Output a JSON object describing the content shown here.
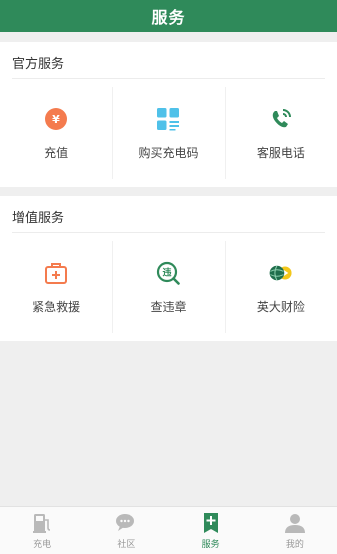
{
  "header": {
    "title": "服务"
  },
  "official": {
    "title": "官方服务",
    "items": [
      {
        "label": "充值",
        "icon": "recharge-yen-icon",
        "color": "#f47b4e"
      },
      {
        "label": "购买充电码",
        "icon": "qr-code-icon",
        "color": "#4fc1e9"
      },
      {
        "label": "客服电话",
        "icon": "phone-icon",
        "color": "#2f8a5a"
      }
    ]
  },
  "value_added": {
    "title": "增值服务",
    "items": [
      {
        "label": "紧急救援",
        "icon": "first-aid-kit-icon",
        "color": "#f47b4e"
      },
      {
        "label": "查违章",
        "icon": "violation-search-icon",
        "color": "#2f8a5a"
      },
      {
        "label": "英大财险",
        "icon": "insurance-globe-icon",
        "color": "#2f8a5a"
      }
    ]
  },
  "tabbar": {
    "tabs": [
      {
        "label": "充电",
        "icon": "charging-pile-icon",
        "active": false
      },
      {
        "label": "社区",
        "icon": "chat-bubbles-icon",
        "active": false
      },
      {
        "label": "服务",
        "icon": "service-bookmark-icon",
        "active": true
      },
      {
        "label": "我的",
        "icon": "user-profile-icon",
        "active": false
      }
    ]
  },
  "colors": {
    "brand": "#2f8a5a",
    "accent": "#f47b4e",
    "info": "#4fc1e9",
    "inactive": "#b9b9b9"
  }
}
